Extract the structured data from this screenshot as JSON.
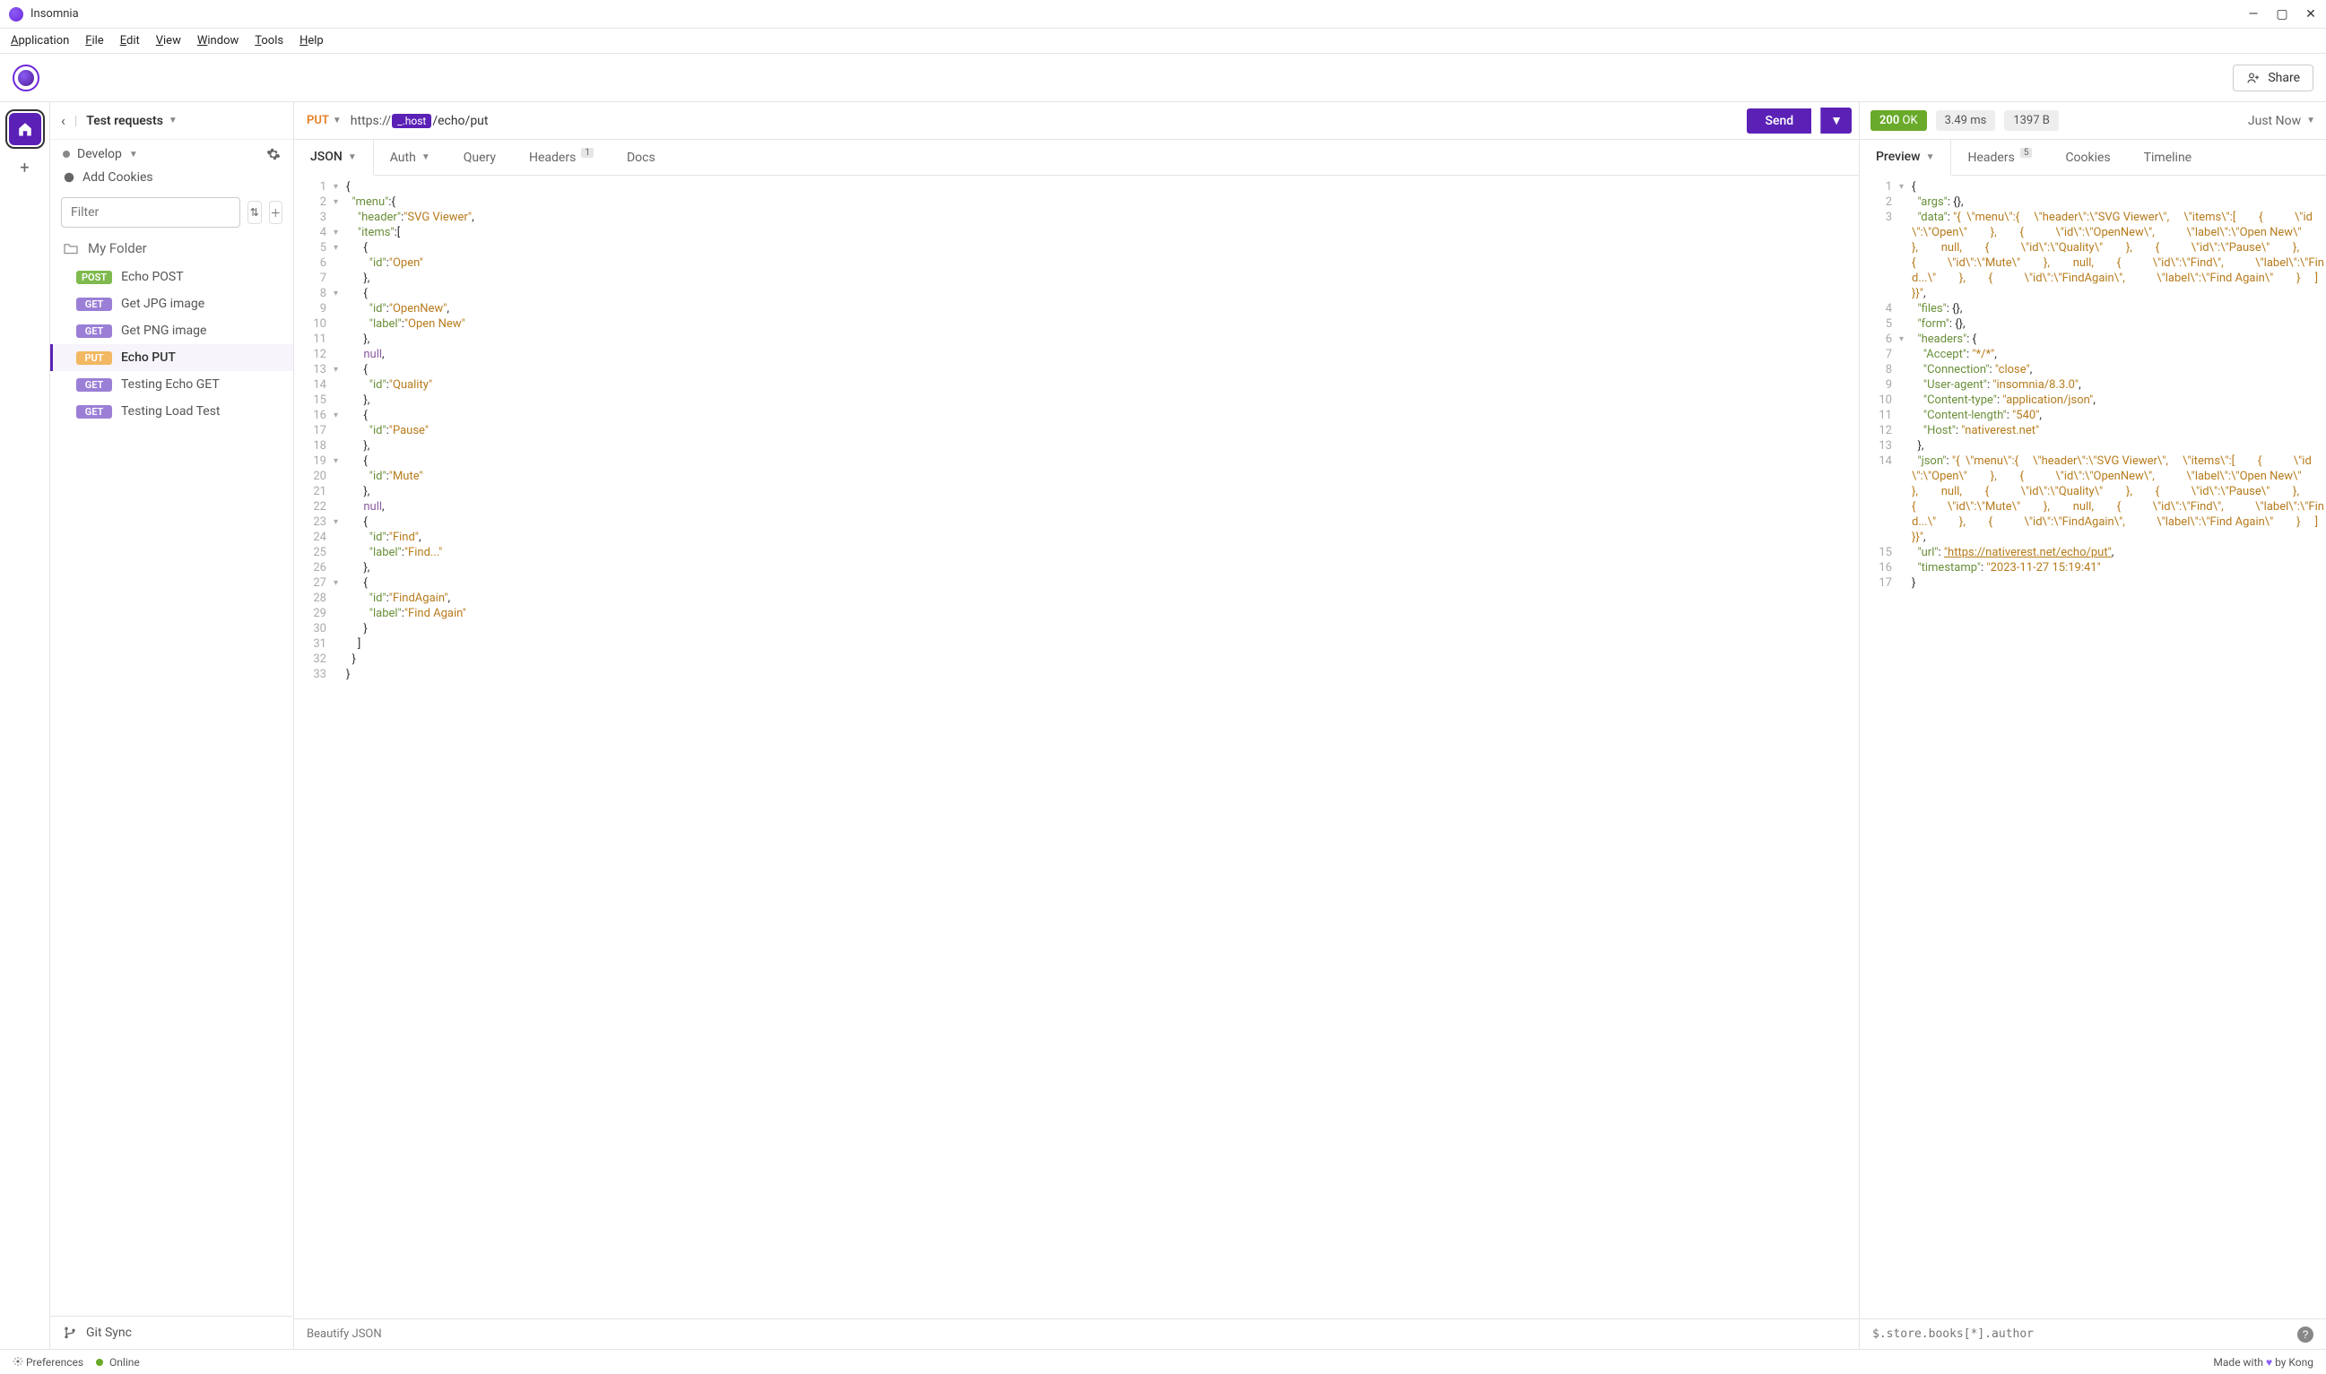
{
  "window": {
    "title": "Insomnia"
  },
  "menubar": [
    "Application",
    "File",
    "Edit",
    "View",
    "Window",
    "Tools",
    "Help"
  ],
  "share_label": "Share",
  "sidebar": {
    "collection": "Test requests",
    "env": "Develop",
    "cookies_label": "Add Cookies",
    "filter_placeholder": "Filter",
    "folder": "My Folder",
    "requests": [
      {
        "method": "POST",
        "name": "Echo POST",
        "active": false
      },
      {
        "method": "GET",
        "name": "Get JPG image",
        "active": false
      },
      {
        "method": "GET",
        "name": "Get PNG image",
        "active": false
      },
      {
        "method": "PUT",
        "name": "Echo PUT",
        "active": true
      },
      {
        "method": "GET",
        "name": "Testing Echo GET",
        "active": false
      },
      {
        "method": "GET",
        "name": "Testing Load Test",
        "active": false
      }
    ],
    "git_sync": "Git Sync"
  },
  "request": {
    "method": "PUT",
    "url_proto": "https://",
    "url_host_tag": "_.host",
    "url_path": "/echo/put",
    "send": "Send",
    "tabs": {
      "body": "JSON",
      "auth": "Auth",
      "query": "Query",
      "headers": "Headers",
      "headers_badge": "1",
      "docs": "Docs"
    },
    "beautify": "Beautify JSON",
    "body_lines": [
      {
        "n": "1",
        "f": "▾",
        "t": [
          [
            "p",
            "{"
          ]
        ]
      },
      {
        "n": "2",
        "f": "▾",
        "t": [
          [
            "p",
            "  "
          ],
          [
            "k",
            "\"menu\""
          ],
          [
            "p",
            ":{"
          ]
        ]
      },
      {
        "n": "3",
        "f": "",
        "t": [
          [
            "p",
            "    "
          ],
          [
            "k",
            "\"header\""
          ],
          [
            "p",
            ":"
          ],
          [
            "s",
            "\"SVG Viewer\""
          ],
          [
            "p",
            ","
          ]
        ]
      },
      {
        "n": "4",
        "f": "▾",
        "t": [
          [
            "p",
            "    "
          ],
          [
            "k",
            "\"items\""
          ],
          [
            "p",
            ":["
          ]
        ]
      },
      {
        "n": "5",
        "f": "▾",
        "t": [
          [
            "p",
            "      {"
          ]
        ]
      },
      {
        "n": "6",
        "f": "",
        "t": [
          [
            "p",
            "        "
          ],
          [
            "k",
            "\"id\""
          ],
          [
            "p",
            ":"
          ],
          [
            "s",
            "\"Open\""
          ]
        ]
      },
      {
        "n": "7",
        "f": "",
        "t": [
          [
            "p",
            "      },"
          ]
        ]
      },
      {
        "n": "8",
        "f": "▾",
        "t": [
          [
            "p",
            "      {"
          ]
        ]
      },
      {
        "n": "9",
        "f": "",
        "t": [
          [
            "p",
            "        "
          ],
          [
            "k",
            "\"id\""
          ],
          [
            "p",
            ":"
          ],
          [
            "s",
            "\"OpenNew\""
          ],
          [
            "p",
            ","
          ]
        ]
      },
      {
        "n": "10",
        "f": "",
        "t": [
          [
            "p",
            "        "
          ],
          [
            "k",
            "\"label\""
          ],
          [
            "p",
            ":"
          ],
          [
            "s",
            "\"Open New\""
          ]
        ]
      },
      {
        "n": "11",
        "f": "",
        "t": [
          [
            "p",
            "      },"
          ]
        ]
      },
      {
        "n": "12",
        "f": "",
        "t": [
          [
            "p",
            "      "
          ],
          [
            "n",
            "null"
          ],
          [
            "p",
            ","
          ]
        ]
      },
      {
        "n": "13",
        "f": "▾",
        "t": [
          [
            "p",
            "      {"
          ]
        ]
      },
      {
        "n": "14",
        "f": "",
        "t": [
          [
            "p",
            "        "
          ],
          [
            "k",
            "\"id\""
          ],
          [
            "p",
            ":"
          ],
          [
            "s",
            "\"Quality\""
          ]
        ]
      },
      {
        "n": "15",
        "f": "",
        "t": [
          [
            "p",
            "      },"
          ]
        ]
      },
      {
        "n": "16",
        "f": "▾",
        "t": [
          [
            "p",
            "      {"
          ]
        ]
      },
      {
        "n": "17",
        "f": "",
        "t": [
          [
            "p",
            "        "
          ],
          [
            "k",
            "\"id\""
          ],
          [
            "p",
            ":"
          ],
          [
            "s",
            "\"Pause\""
          ]
        ]
      },
      {
        "n": "18",
        "f": "",
        "t": [
          [
            "p",
            "      },"
          ]
        ]
      },
      {
        "n": "19",
        "f": "▾",
        "t": [
          [
            "p",
            "      {"
          ]
        ]
      },
      {
        "n": "20",
        "f": "",
        "t": [
          [
            "p",
            "        "
          ],
          [
            "k",
            "\"id\""
          ],
          [
            "p",
            ":"
          ],
          [
            "s",
            "\"Mute\""
          ]
        ]
      },
      {
        "n": "21",
        "f": "",
        "t": [
          [
            "p",
            "      },"
          ]
        ]
      },
      {
        "n": "22",
        "f": "",
        "t": [
          [
            "p",
            "      "
          ],
          [
            "n",
            "null"
          ],
          [
            "p",
            ","
          ]
        ]
      },
      {
        "n": "23",
        "f": "▾",
        "t": [
          [
            "p",
            "      {"
          ]
        ]
      },
      {
        "n": "24",
        "f": "",
        "t": [
          [
            "p",
            "        "
          ],
          [
            "k",
            "\"id\""
          ],
          [
            "p",
            ":"
          ],
          [
            "s",
            "\"Find\""
          ],
          [
            "p",
            ","
          ]
        ]
      },
      {
        "n": "25",
        "f": "",
        "t": [
          [
            "p",
            "        "
          ],
          [
            "k",
            "\"label\""
          ],
          [
            "p",
            ":"
          ],
          [
            "s",
            "\"Find...\""
          ]
        ]
      },
      {
        "n": "26",
        "f": "",
        "t": [
          [
            "p",
            "      },"
          ]
        ]
      },
      {
        "n": "27",
        "f": "▾",
        "t": [
          [
            "p",
            "      {"
          ]
        ]
      },
      {
        "n": "28",
        "f": "",
        "t": [
          [
            "p",
            "        "
          ],
          [
            "k",
            "\"id\""
          ],
          [
            "p",
            ":"
          ],
          [
            "s",
            "\"FindAgain\""
          ],
          [
            "p",
            ","
          ]
        ]
      },
      {
        "n": "29",
        "f": "",
        "t": [
          [
            "p",
            "        "
          ],
          [
            "k",
            "\"label\""
          ],
          [
            "p",
            ":"
          ],
          [
            "s",
            "\"Find Again\""
          ]
        ]
      },
      {
        "n": "30",
        "f": "",
        "t": [
          [
            "p",
            "      }"
          ]
        ]
      },
      {
        "n": "31",
        "f": "",
        "t": [
          [
            "p",
            "    ]"
          ]
        ]
      },
      {
        "n": "32",
        "f": "",
        "t": [
          [
            "p",
            "  }"
          ]
        ]
      },
      {
        "n": "33",
        "f": "",
        "t": [
          [
            "p",
            "}"
          ]
        ]
      }
    ]
  },
  "response": {
    "status_code": "200",
    "status_text": "OK",
    "time": "3.49 ms",
    "size": "1397 B",
    "age": "Just Now",
    "tabs": {
      "preview": "Preview",
      "headers": "Headers",
      "headers_badge": "5",
      "cookies": "Cookies",
      "timeline": "Timeline"
    },
    "jsonpath_placeholder": "$.store.books[*].author",
    "body_lines": [
      {
        "n": "1",
        "f": "▾",
        "t": [
          [
            "p",
            "{"
          ]
        ]
      },
      {
        "n": "2",
        "f": "",
        "t": [
          [
            "p",
            "  "
          ],
          [
            "k",
            "\"args\""
          ],
          [
            "p",
            ": {},"
          ]
        ]
      },
      {
        "n": "3",
        "f": "",
        "t": [
          [
            "p",
            "  "
          ],
          [
            "k",
            "\"data\""
          ],
          [
            "p",
            ": "
          ],
          [
            "s",
            "\"{  \\\"menu\\\":{     \\\"header\\\":\\\"SVG Viewer\\\",     \\\"items\\\":[        {           \\\"id\\\":\\\"Open\\\"        },        {           \\\"id\\\":\\\"OpenNew\\\",           \\\"label\\\":\\\"Open New\\\"        },        null,        {           \\\"id\\\":\\\"Quality\\\"        },        {           \\\"id\\\":\\\"Pause\\\"        },        {           \\\"id\\\":\\\"Mute\\\"        },        null,        {           \\\"id\\\":\\\"Find\\\",           \\\"label\\\":\\\"Find...\\\"        },        {           \\\"id\\\":\\\"FindAgain\\\",           \\\"label\\\":\\\"Find Again\\\"        }     ]  }}\""
          ],
          [
            "p",
            ","
          ]
        ]
      },
      {
        "n": "4",
        "f": "",
        "t": [
          [
            "p",
            "  "
          ],
          [
            "k",
            "\"files\""
          ],
          [
            "p",
            ": {},"
          ]
        ]
      },
      {
        "n": "5",
        "f": "",
        "t": [
          [
            "p",
            "  "
          ],
          [
            "k",
            "\"form\""
          ],
          [
            "p",
            ": {},"
          ]
        ]
      },
      {
        "n": "6",
        "f": "▾",
        "t": [
          [
            "p",
            "  "
          ],
          [
            "k",
            "\"headers\""
          ],
          [
            "p",
            ": {"
          ]
        ]
      },
      {
        "n": "7",
        "f": "",
        "t": [
          [
            "p",
            "    "
          ],
          [
            "k",
            "\"Accept\""
          ],
          [
            "p",
            ": "
          ],
          [
            "s",
            "\"*/*\""
          ],
          [
            "p",
            ","
          ]
        ]
      },
      {
        "n": "8",
        "f": "",
        "t": [
          [
            "p",
            "    "
          ],
          [
            "k",
            "\"Connection\""
          ],
          [
            "p",
            ": "
          ],
          [
            "s",
            "\"close\""
          ],
          [
            "p",
            ","
          ]
        ]
      },
      {
        "n": "9",
        "f": "",
        "t": [
          [
            "p",
            "    "
          ],
          [
            "k",
            "\"User-agent\""
          ],
          [
            "p",
            ": "
          ],
          [
            "s",
            "\"insomnia/8.3.0\""
          ],
          [
            "p",
            ","
          ]
        ]
      },
      {
        "n": "10",
        "f": "",
        "t": [
          [
            "p",
            "    "
          ],
          [
            "k",
            "\"Content-type\""
          ],
          [
            "p",
            ": "
          ],
          [
            "s",
            "\"application/json\""
          ],
          [
            "p",
            ","
          ]
        ]
      },
      {
        "n": "11",
        "f": "",
        "t": [
          [
            "p",
            "    "
          ],
          [
            "k",
            "\"Content-length\""
          ],
          [
            "p",
            ": "
          ],
          [
            "s",
            "\"540\""
          ],
          [
            "p",
            ","
          ]
        ]
      },
      {
        "n": "12",
        "f": "",
        "t": [
          [
            "p",
            "    "
          ],
          [
            "k",
            "\"Host\""
          ],
          [
            "p",
            ": "
          ],
          [
            "s",
            "\"nativerest.net\""
          ]
        ]
      },
      {
        "n": "13",
        "f": "",
        "t": [
          [
            "p",
            "  },"
          ]
        ]
      },
      {
        "n": "14",
        "f": "",
        "t": [
          [
            "p",
            "  "
          ],
          [
            "k",
            "\"json\""
          ],
          [
            "p",
            ": "
          ],
          [
            "s",
            "\"{  \\\"menu\\\":{     \\\"header\\\":\\\"SVG Viewer\\\",     \\\"items\\\":[        {           \\\"id\\\":\\\"Open\\\"        },        {           \\\"id\\\":\\\"OpenNew\\\",           \\\"label\\\":\\\"Open New\\\"        },        null,        {           \\\"id\\\":\\\"Quality\\\"        },        {           \\\"id\\\":\\\"Pause\\\"        },        {           \\\"id\\\":\\\"Mute\\\"        },        null,        {           \\\"id\\\":\\\"Find\\\",           \\\"label\\\":\\\"Find...\\\"        },        {           \\\"id\\\":\\\"FindAgain\\\",           \\\"label\\\":\\\"Find Again\\\"        }     ]  }}\""
          ],
          [
            "p",
            ","
          ]
        ]
      },
      {
        "n": "15",
        "f": "",
        "t": [
          [
            "p",
            "  "
          ],
          [
            "k",
            "\"url\""
          ],
          [
            "p",
            ": "
          ],
          [
            "u",
            "\"https://nativerest.net/echo/put\""
          ],
          [
            "p",
            ","
          ]
        ]
      },
      {
        "n": "16",
        "f": "",
        "t": [
          [
            "p",
            "  "
          ],
          [
            "k",
            "\"timestamp\""
          ],
          [
            "p",
            ": "
          ],
          [
            "s",
            "\"2023-11-27 15:19:41\""
          ]
        ]
      },
      {
        "n": "17",
        "f": "",
        "t": [
          [
            "p",
            "}"
          ]
        ]
      }
    ]
  },
  "statusbar": {
    "prefs": "Preferences",
    "online": "Online",
    "made_prefix": "Made with ",
    "made_suffix": " by Kong"
  }
}
